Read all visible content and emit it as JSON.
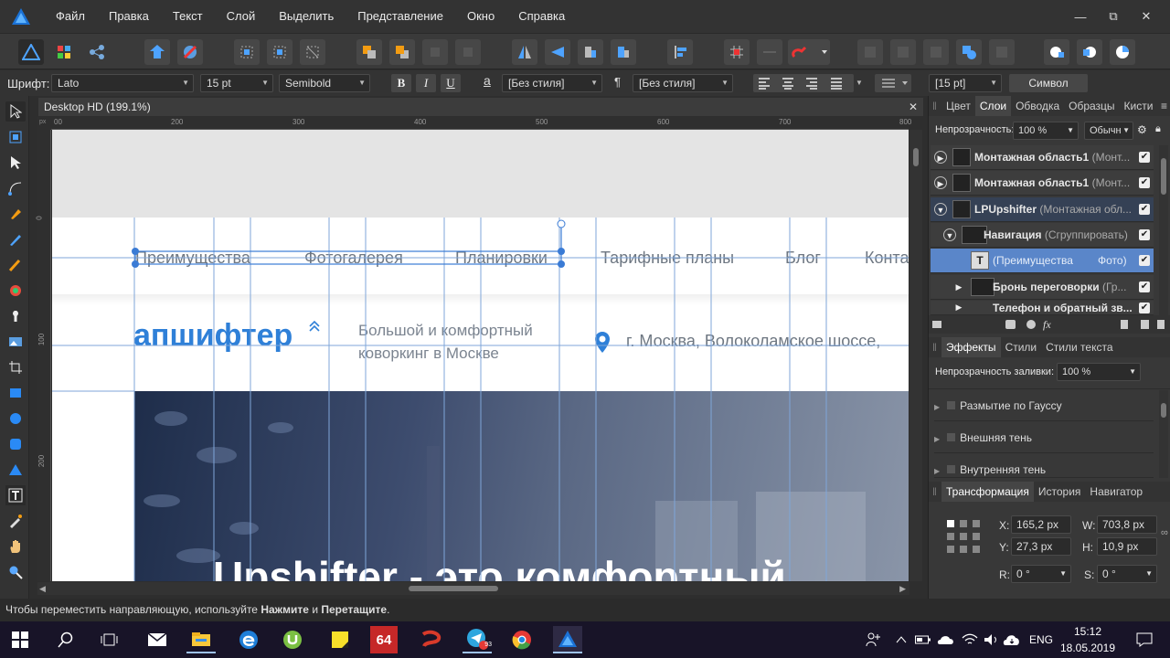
{
  "menu": {
    "items": [
      "Файл",
      "Правка",
      "Текст",
      "Слой",
      "Выделить",
      "Представление",
      "Окно",
      "Справка"
    ]
  },
  "window_controls": {
    "minimize": "—",
    "restore": "⧉",
    "close": "✕"
  },
  "context_bar": {
    "font_label": "Шрифт:",
    "font_name": "Lato",
    "font_size": "15 pt",
    "font_weight": "Semibold",
    "bold": "B",
    "italic": "I",
    "underline": "U",
    "char_style_glyph": "a",
    "char_style": "[Без стиля]",
    "para_glyph": "¶",
    "para_style": "[Без стиля]",
    "leading": "[15 pt]",
    "symbol_button": "Символ"
  },
  "document": {
    "tab_title": "Desktop HD (199.1%)",
    "close": "✕",
    "ruler_unit": "px",
    "h_ruler_ticks": [
      "00",
      "200",
      "300",
      "400",
      "500",
      "600",
      "700",
      "800"
    ],
    "v_ruler_ticks": [
      "0",
      "100",
      "200"
    ]
  },
  "canvas": {
    "nav_items": [
      "Преимущества",
      "Фотогалерея",
      "Планировки",
      "Тарифные планы",
      "Блог",
      "Конта"
    ],
    "logo": "апшифтер",
    "tagline_line1": "Большой и комфортный",
    "tagline_line2": "коворкинг в Москве",
    "address": "г. Москва, Волоколамское шоссе,",
    "hero_text": "Upshifter - это комфортный",
    "accent_color": "#2f80d8"
  },
  "status": {
    "prefix": "Чтобы переместить направляющую, используйте ",
    "bold1": "Нажмите",
    "mid": " и ",
    "bold2": "Перетащите",
    "suffix": "."
  },
  "panel": {
    "tabs": [
      "Цвет",
      "Слои",
      "Обводка",
      "Образцы",
      "Кисти"
    ],
    "opacity_label": "Непрозрачность:",
    "opacity_value": "100 %",
    "blend_mode": "Обычн",
    "layers": [
      {
        "name": "Монтажная область1",
        "type": " (Монт..."
      },
      {
        "name": "Монтажная область1",
        "type": " (Монт..."
      },
      {
        "name": "LPUpshifter",
        "type": " (Монтажная обл..."
      },
      {
        "name": "Навигация",
        "type": " (Сгруппировать)"
      },
      {
        "name": "(Преимущества",
        "type": "Фото)"
      },
      {
        "name": "Бронь переговорки",
        "type": " (Гр..."
      },
      {
        "name": "Телефон и обратный зв...",
        "type": ""
      }
    ],
    "effects_tabs": [
      "Эффекты",
      "Стили",
      "Стили текста"
    ],
    "fill_opacity_label": "Непрозрачность заливки:",
    "fill_opacity_value": "100 %",
    "effects": [
      "Размытие по Гауссу",
      "Внешняя тень",
      "Внутренняя тень"
    ],
    "transform_tabs": [
      "Трансформация",
      "История",
      "Навигатор"
    ],
    "transform": {
      "x_label": "X:",
      "x": "165,2 px",
      "w_label": "W:",
      "w": "703,8 px",
      "y_label": "Y:",
      "y": "27,3 px",
      "h_label": "H:",
      "h": "10,9 px",
      "r_label": "R:",
      "r": "0 °",
      "s_label": "S:",
      "s": "0 °"
    }
  },
  "taskbar": {
    "badge_64": "64",
    "telegram_badge": "93",
    "lang": "ENG",
    "time": "15:12",
    "date": "18.05.2019"
  }
}
